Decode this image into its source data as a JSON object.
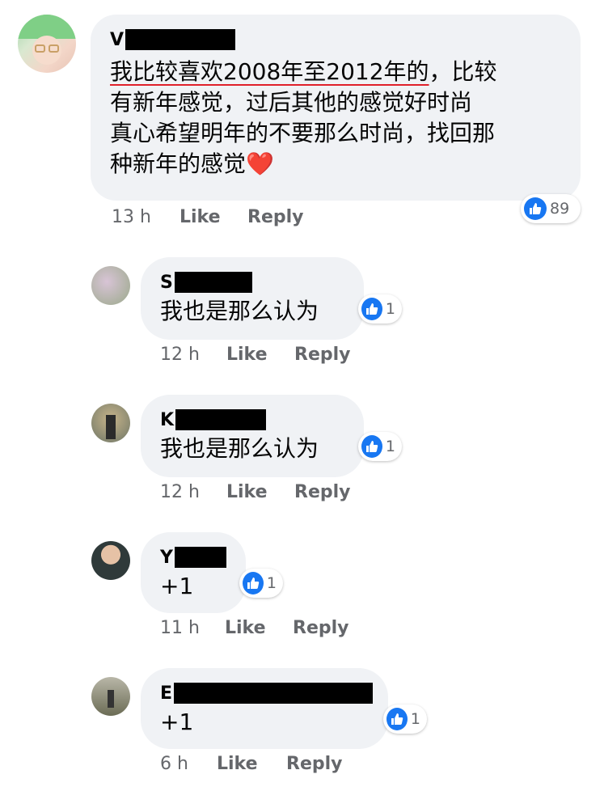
{
  "comments": [
    {
      "name_initial": "V",
      "text_underlined": "我比较喜欢2008年至2012年的",
      "text_lines": [
        "，比较",
        "有新年感觉，过后其他的感觉好时尚",
        "真心希望明年的不要那么时尚，找回那",
        "种新年的感觉"
      ],
      "heart": "❤️",
      "time": "13 h",
      "like_label": "Like",
      "reply_label": "Reply",
      "reaction_count": "89"
    },
    {
      "name_initial": "S",
      "text": "我也是那么认为",
      "time": "12 h",
      "like_label": "Like",
      "reply_label": "Reply",
      "reaction_count": "1"
    },
    {
      "name_initial": "K",
      "text": "我也是那么认为",
      "time": "12 h",
      "like_label": "Like",
      "reply_label": "Reply",
      "reaction_count": "1"
    },
    {
      "name_initial": "Y",
      "text": "+1",
      "time": "11 h",
      "like_label": "Like",
      "reply_label": "Reply",
      "reaction_count": "1"
    },
    {
      "name_initial": "E",
      "text": "+1",
      "time": "6 h",
      "like_label": "Like",
      "reply_label": "Reply",
      "reaction_count": "1"
    }
  ],
  "colors": {
    "bubble": "#f0f2f5",
    "like_blue": "#1877f2",
    "meta_gray": "#65676b",
    "underline_red": "#e0202a"
  },
  "icons": [
    "like-thumb-icon"
  ]
}
